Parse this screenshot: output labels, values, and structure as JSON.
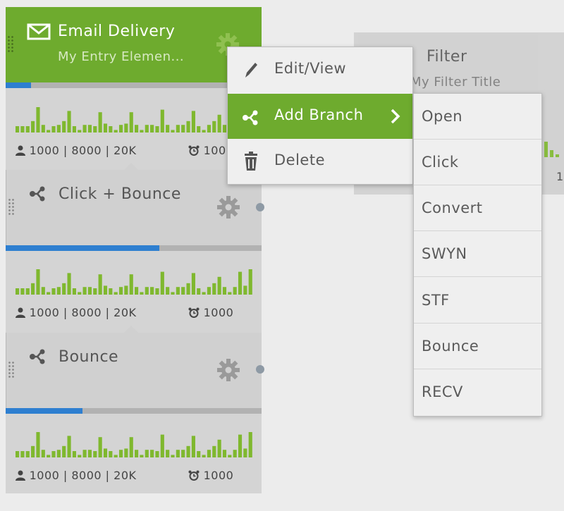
{
  "colors": {
    "accent_green": "#6eab2e",
    "bar_green": "#7fb82e",
    "progress_blue": "#2e7fd0",
    "card_gray": "#d0d0d0",
    "menu_bg": "#efefef"
  },
  "nodes": [
    {
      "title": "Email Delivery",
      "subtitle": "My Entry Elemen...",
      "icon": "envelope-icon",
      "progress_fraction": 0.1,
      "stats_prefix": "1000 | 8000 | 20K",
      "stats_timer": "100"
    },
    {
      "title": "Click + Bounce",
      "icon": "branch-icon",
      "progress_fraction": 0.6,
      "stats_prefix": "1000 | 8000 | 20K",
      "stats_timer": "1000"
    },
    {
      "title": "Bounce",
      "icon": "branch-icon",
      "progress_fraction": 0.3,
      "stats_prefix": "1000 | 8000 | 20K",
      "stats_timer": "1000"
    }
  ],
  "filter_card": {
    "title": "Filter",
    "subtitle": "My Filter Title",
    "stat_fragment": "1"
  },
  "context_menu": {
    "items": [
      {
        "label": "Edit/View",
        "icon": "pencil-icon"
      },
      {
        "label": "Add Branch",
        "icon": "branch-icon",
        "active": true
      },
      {
        "label": "Delete",
        "icon": "trash-icon"
      }
    ]
  },
  "branch_submenu": {
    "items": [
      "Open",
      "Click",
      "Convert",
      "SWYN",
      "STF",
      "Bounce",
      "RECV"
    ]
  }
}
